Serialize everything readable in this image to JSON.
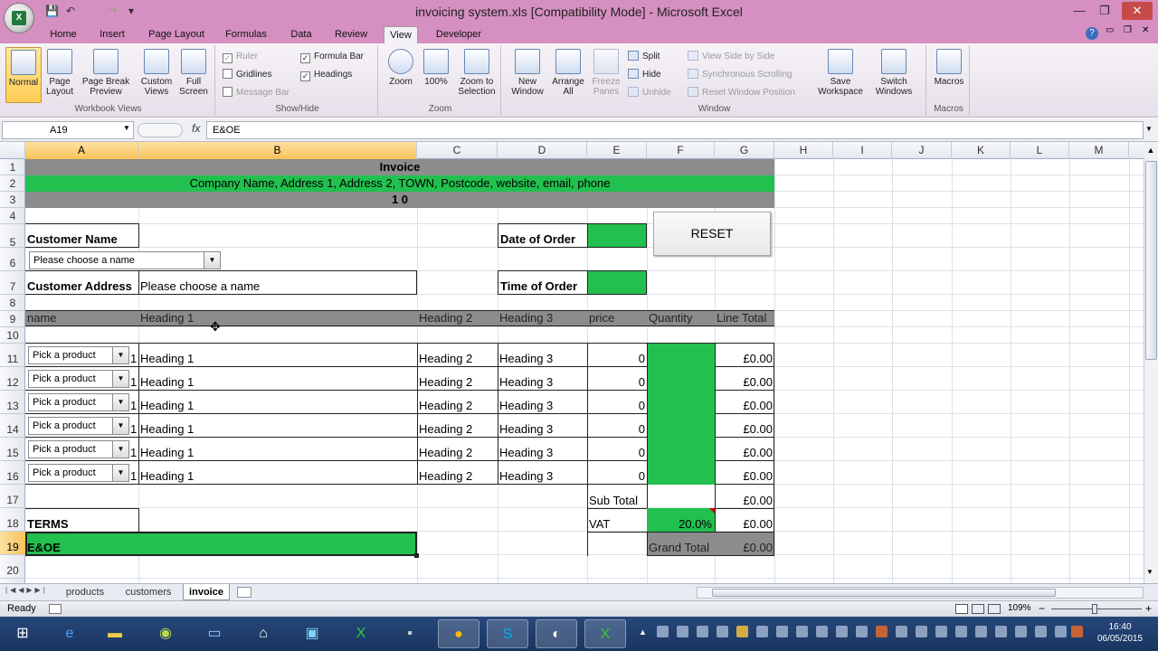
{
  "window": {
    "title": "invoicing system.xls  [Compatibility Mode] - Microsoft Excel",
    "minimize": "—",
    "maximize": "❐",
    "close": "✕"
  },
  "ribbon_tabs": [
    "Home",
    "Insert",
    "Page Layout",
    "Formulas",
    "Data",
    "Review",
    "View",
    "Developer"
  ],
  "active_tab": "View",
  "ribbon": {
    "workbook_views": {
      "label": "Workbook Views",
      "buttons": [
        "Normal",
        "Page Layout",
        "Page Break Preview",
        "Custom Views",
        "Full Screen"
      ]
    },
    "show_hide": {
      "label": "Show/Hide",
      "ruler": "Ruler",
      "formula_bar": "Formula Bar",
      "gridlines": "Gridlines",
      "headings": "Headings",
      "message_bar": "Message Bar"
    },
    "zoom": {
      "label": "Zoom",
      "buttons": [
        "Zoom",
        "100%",
        "Zoom to Selection"
      ]
    },
    "window": {
      "label": "Window",
      "buttons": [
        "New Window",
        "Arrange All",
        "Freeze Panes"
      ],
      "split": "Split",
      "hide": "Hide",
      "unhide": "Unhide",
      "view_side": "View Side by Side",
      "sync_scroll": "Synchronous Scrolling",
      "reset_pos": "Reset Window Position",
      "save_ws": "Save Workspace",
      "switch_win": "Switch Windows"
    },
    "macros": {
      "label": "Macros",
      "button": "Macros"
    }
  },
  "formula_bar": {
    "name_box": "A19",
    "fx": "fx",
    "content": "E&OE"
  },
  "columns": [
    "A",
    "B",
    "C",
    "D",
    "E",
    "F",
    "G",
    "H",
    "I",
    "J",
    "K",
    "L",
    "M"
  ],
  "rows": [
    "1",
    "2",
    "3",
    "4",
    "5",
    "6",
    "7",
    "8",
    "9",
    "10",
    "11",
    "12",
    "13",
    "14",
    "15",
    "16",
    "17",
    "18",
    "19",
    "20"
  ],
  "sheet": {
    "invoice_title": "Invoice",
    "company_line": "Company Name, Address 1, Address 2, TOWN, Postcode, website, email, phone",
    "invoice_number": "1 0",
    "customer_name_label": "Customer Name",
    "customer_dropdown": "Please choose a name",
    "customer_address_label": "Customer Address",
    "customer_address_value": "Please choose a name",
    "date_of_order_label": "Date of Order",
    "time_of_order_label": "Time of Order",
    "reset_button": "RESET",
    "headers": [
      "name",
      "Heading 1",
      "Heading 2",
      "Heading 3",
      "price",
      "Quantity",
      "Line Total"
    ],
    "lines": [
      {
        "product": "Pick a product",
        "n": "1",
        "h1": "Heading 1",
        "h2": "Heading 2",
        "h3": "Heading 3",
        "price": "0",
        "total": "£0.00"
      },
      {
        "product": "Pick a product",
        "n": "1",
        "h1": "Heading 1",
        "h2": "Heading 2",
        "h3": "Heading 3",
        "price": "0",
        "total": "£0.00"
      },
      {
        "product": "Pick a product",
        "n": "1",
        "h1": "Heading 1",
        "h2": "Heading 2",
        "h3": "Heading 3",
        "price": "0",
        "total": "£0.00"
      },
      {
        "product": "Pick a product",
        "n": "1",
        "h1": "Heading 1",
        "h2": "Heading 2",
        "h3": "Heading 3",
        "price": "0",
        "total": "£0.00"
      },
      {
        "product": "Pick a product",
        "n": "1",
        "h1": "Heading 1",
        "h2": "Heading 2",
        "h3": "Heading 3",
        "price": "0",
        "total": "£0.00"
      },
      {
        "product": "Pick a product",
        "n": "1",
        "h1": "Heading 1",
        "h2": "Heading 2",
        "h3": "Heading 3",
        "price": "0",
        "total": "£0.00"
      }
    ],
    "subtotal_label": "Sub Total",
    "subtotal_value": "£0.00",
    "vat_label": "VAT",
    "vat_rate": "20.0%",
    "vat_value": "£0.00",
    "grand_total_label": "Grand Total",
    "grand_total_value": "£0.00",
    "terms_label": "TERMS",
    "terms_value": "E&OE"
  },
  "sheet_tabs": [
    "products",
    "customers",
    "invoice"
  ],
  "active_sheet": "invoice",
  "status": {
    "ready": "Ready",
    "zoom": "109%",
    "minus": "−",
    "plus": "+"
  },
  "taskbar": {
    "time": "16:40",
    "date": "06/05/2015"
  },
  "colors": {
    "green": "#22c04f",
    "gray_band": "#8c8c8c",
    "title_bar": "#d58fc0"
  }
}
